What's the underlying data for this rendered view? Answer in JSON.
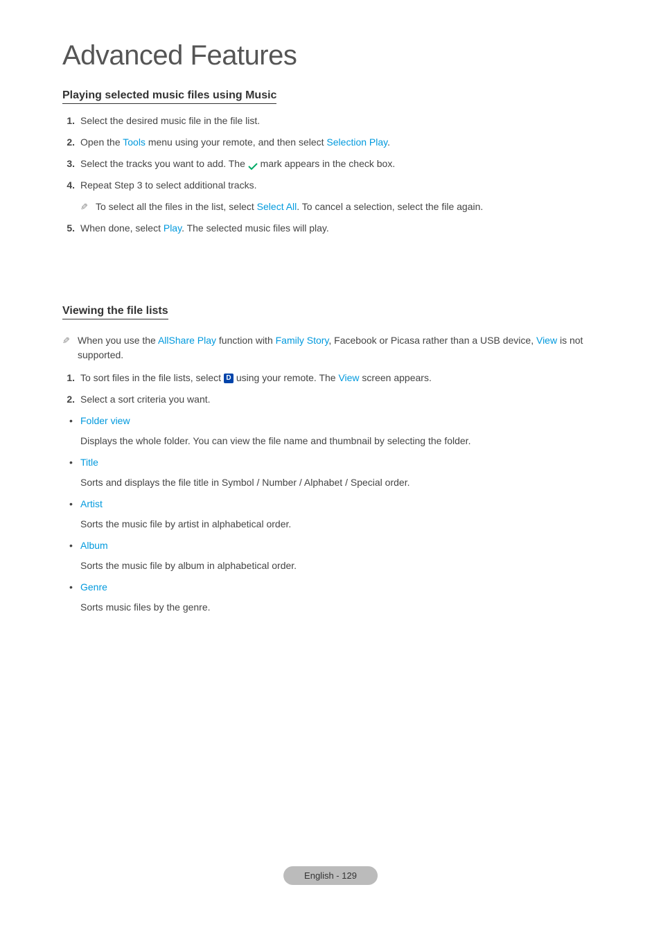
{
  "page_title": "Advanced Features",
  "section1": {
    "heading": "Playing selected music files using Music",
    "steps": [
      {
        "num": "1.",
        "parts": [
          "Select the desired music file in the file list."
        ]
      },
      {
        "num": "2.",
        "parts": [
          "Open the ",
          {
            "t": "Tools",
            "c": "blue"
          },
          " menu using your remote, and then select ",
          {
            "t": "Selection Play",
            "c": "blue"
          },
          "."
        ]
      },
      {
        "num": "3.",
        "parts": [
          "Select the tracks you want to add. The ",
          {
            "icon": "check"
          },
          " mark appears in the check box."
        ]
      },
      {
        "num": "4.",
        "parts": [
          "Repeat Step 3 to select additional tracks."
        ],
        "note": [
          "To select all the files in the list, select ",
          {
            "t": "Select All",
            "c": "blue"
          },
          ". To cancel a selection, select the file again."
        ]
      },
      {
        "num": "5.",
        "parts": [
          "When done, select ",
          {
            "t": "Play",
            "c": "blue"
          },
          ". The selected music files will play."
        ]
      }
    ]
  },
  "section2": {
    "heading": "Viewing the file lists",
    "note": [
      "When you use the ",
      {
        "t": "AllShare Play",
        "c": "blue"
      },
      " function with ",
      {
        "t": "Family Story",
        "c": "blue"
      },
      ", Facebook or Picasa rather than a USB device, ",
      {
        "t": "View",
        "c": "blue"
      },
      " is not supported."
    ],
    "steps": [
      {
        "num": "1.",
        "parts": [
          "To sort files in the file lists, select ",
          {
            "icon": "d"
          },
          " using your remote. The ",
          {
            "t": "View",
            "c": "blue"
          },
          " screen appears."
        ]
      },
      {
        "num": "2.",
        "parts": [
          "Select a sort criteria you want."
        ]
      }
    ],
    "bullets": [
      {
        "title": "Folder view",
        "desc": "Displays the whole folder. You can view the file name and thumbnail by selecting the folder."
      },
      {
        "title": "Title",
        "desc": "Sorts and displays the file title in Symbol / Number / Alphabet / Special order."
      },
      {
        "title": "Artist",
        "desc": "Sorts the music file by artist in alphabetical order."
      },
      {
        "title": "Album",
        "desc": "Sorts the music file by album in alphabetical order."
      },
      {
        "title": "Genre",
        "desc": "Sorts music files by the genre."
      }
    ]
  },
  "footer": "English - 129",
  "icons": {
    "d_label": "D"
  }
}
